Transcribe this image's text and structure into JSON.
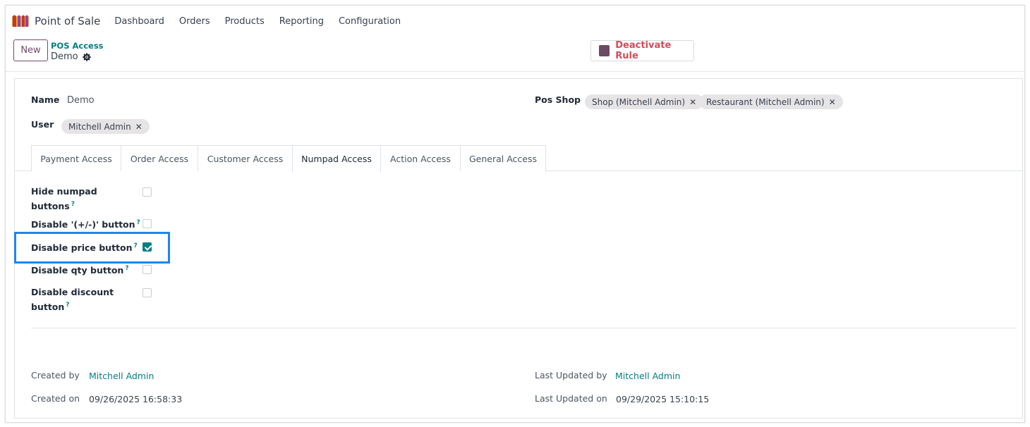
{
  "navbar": {
    "app_name": "Point of Sale",
    "menu": [
      "Dashboard",
      "Orders",
      "Products",
      "Reporting",
      "Configuration"
    ]
  },
  "control": {
    "new_label": "New",
    "breadcrumb": "POS Access",
    "record_name": "Demo",
    "deactivate_label": "Deactivate Rule"
  },
  "form": {
    "name_label": "Name",
    "name_value": "Demo",
    "user_label": "User",
    "user_tags": [
      "Mitchell Admin"
    ],
    "pos_shop_label": "Pos Shop",
    "pos_shop_tags": [
      "Shop (Mitchell Admin)",
      "Restaurant (Mitchell Admin)"
    ]
  },
  "tabs": [
    "Payment Access",
    "Order Access",
    "Customer Access",
    "Numpad Access",
    "Action Access",
    "General Access"
  ],
  "active_tab": "Numpad Access",
  "fields": [
    {
      "label": "Hide numpad buttons",
      "checked": false
    },
    {
      "label": "Disable '(+/-)' button",
      "checked": false
    },
    {
      "label": "Disable price button",
      "checked": true
    },
    {
      "label": "Disable qty button",
      "checked": false
    },
    {
      "label": "Disable discount button",
      "checked": false
    }
  ],
  "help_mark": "?",
  "meta": {
    "created_by_label": "Created by",
    "created_by": "Mitchell Admin",
    "created_on_label": "Created on",
    "created_on": "09/26/2025 16:58:33",
    "updated_by_label": "Last Updated by",
    "updated_by": "Mitchell Admin",
    "updated_on_label": "Last Updated on",
    "updated_on": "09/29/2025 15:10:15"
  },
  "colors": {
    "brand": "#714b67",
    "link": "#017e84",
    "danger": "#d44c59",
    "highlight": "#1b87f0"
  }
}
